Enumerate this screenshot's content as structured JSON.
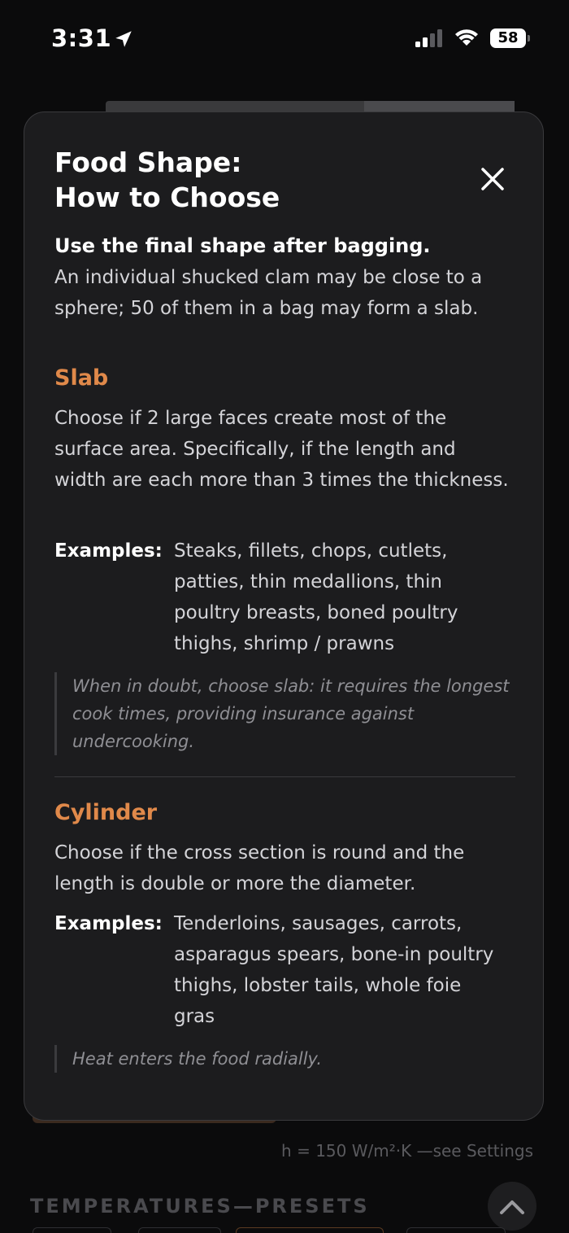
{
  "status_bar": {
    "time": "3:31",
    "battery": "58",
    "icons": [
      "location-arrow-icon",
      "cellular-signal-icon",
      "wifi-icon",
      "battery-icon"
    ]
  },
  "background": {
    "heat_note": "h = 150 W/m²·K —see Settings",
    "section_title": "TEMPERATURES—PRESETS"
  },
  "modal": {
    "title_line1": "Food Shape:",
    "title_line2": "How to Choose",
    "intro_lead": "Use the final shape after bagging.",
    "intro_body": "An individual shucked clam may be close to a sphere; 50 of them in a bag may form a slab.",
    "sections": [
      {
        "heading": "Slab",
        "description": "Choose if 2 large faces create most of the surface area. Specifically, if the length and width are each more than 3 times the thickness.",
        "examples_label": "Examples:",
        "examples": "Steaks, fillets, chops, cutlets, patties, thin medallions, thin poultry breasts, boned poultry thighs, shrimp / prawns",
        "note": "When in doubt, choose slab: it requires the longest cook times, providing insurance against undercooking."
      },
      {
        "heading": "Cylinder",
        "description": "Choose if the cross section is round and the length is double or more the diameter.",
        "examples_label": "Examples:",
        "examples": "Tenderloins, sausages, carrots, asparagus spears, bone-in poultry thighs, lobster tails, whole foie gras",
        "note": "Heat enters the food radially."
      }
    ]
  },
  "colors": {
    "accent": "#e0894a",
    "sheet_bg": "#1c1c1e",
    "page_bg": "#0b0b0c"
  }
}
